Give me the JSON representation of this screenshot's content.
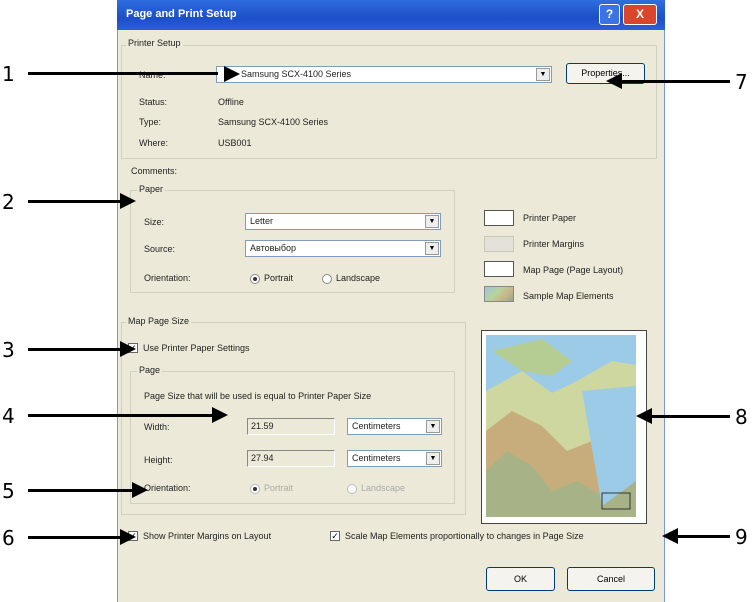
{
  "window": {
    "title": "Page and Print Setup",
    "help_label": "?",
    "close_label": "X"
  },
  "printer_setup": {
    "group_label": "Printer Setup",
    "name_label": "Name:",
    "name_value": "Samsung SCX-4100 Series",
    "properties_label": "Properties...",
    "status_label": "Status:",
    "status_value": "Offline",
    "type_label": "Type:",
    "type_value": "Samsung SCX-4100 Series",
    "where_label": "Where:",
    "where_value": "USB001",
    "comments_label": "Comments:"
  },
  "paper": {
    "group_label": "Paper",
    "size_label": "Size:",
    "size_value": "Letter",
    "source_label": "Source:",
    "source_value": "Автовыбор",
    "orientation_label": "Orientation:",
    "portrait_label": "Portrait",
    "landscape_label": "Landscape"
  },
  "legend": {
    "printer_paper": "Printer Paper",
    "printer_margins": "Printer Margins",
    "map_page": "Map Page (Page Layout)",
    "sample_elements": "Sample Map Elements"
  },
  "map_page_size": {
    "group_label": "Map Page Size",
    "use_printer_label": "Use Printer Paper Settings",
    "page_group_label": "Page",
    "info_text": "Page Size that will be used is equal to Printer Paper Size",
    "width_label": "Width:",
    "width_value": "21.59",
    "height_label": "Height:",
    "height_value": "27.94",
    "units_value": "Centimeters",
    "orientation_label": "Orientation:",
    "portrait_label": "Portrait",
    "landscape_label": "Landscape"
  },
  "options": {
    "show_margins_label": "Show Printer Margins on Layout",
    "scale_elements_label": "Scale Map Elements proportionally to changes in Page Size"
  },
  "buttons": {
    "ok": "OK",
    "cancel": "Cancel"
  },
  "callouts": [
    "1",
    "2",
    "3",
    "4",
    "5",
    "6",
    "7",
    "8",
    "9"
  ]
}
